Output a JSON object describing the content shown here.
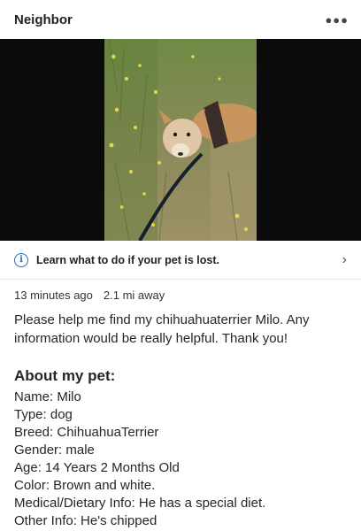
{
  "header": {
    "title": "Neighbor",
    "more_icon": "more-horizontal-icon"
  },
  "photo": {
    "subject": "chihuahua-terrier-photo"
  },
  "lost_banner": {
    "text": "Learn what to do if your pet is lost.",
    "icon": "info-icon",
    "chevron": "chevron-right-icon"
  },
  "post": {
    "time": "13 minutes ago",
    "distance": "2.1 mi away",
    "body": "Please help me find my chihuahuaterrier  Milo. Any information would be really helpful. Thank you!"
  },
  "about": {
    "heading": "About my pet:",
    "name": "Name: Milo",
    "type": "Type: dog",
    "breed": "Breed: ChihuahuaTerrier",
    "gender": "Gender: male",
    "age": "Age: 14 Years 2 Months Old",
    "color": "Color: Brown and white.",
    "medical": "Medical/Dietary Info: He has a special diet.",
    "other": "Other Info: He's chipped"
  },
  "colors": {
    "info_blue": "#2a6db0",
    "media_bg": "#0b0b0b"
  }
}
